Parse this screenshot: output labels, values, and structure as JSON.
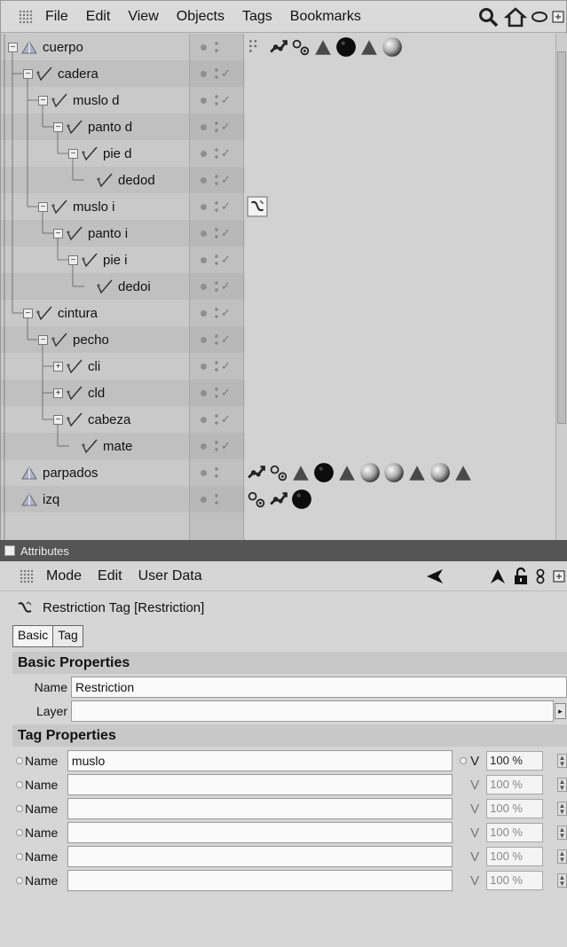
{
  "object_manager": {
    "menu": [
      "File",
      "Edit",
      "View",
      "Objects",
      "Tags",
      "Bookmarks"
    ],
    "header_icons": [
      "search-icon",
      "home-icon",
      "ellipse-icon",
      "window-expand-icon"
    ],
    "objects": [
      {
        "name": "cuerpo",
        "type": "joint-root",
        "expanded": true
      },
      {
        "name": "cadera",
        "type": "bone",
        "expanded": true
      },
      {
        "name": "muslo d",
        "type": "bone",
        "expanded": true
      },
      {
        "name": "panto d",
        "type": "bone",
        "expanded": true
      },
      {
        "name": "pie d",
        "type": "bone",
        "expanded": true
      },
      {
        "name": "dedod",
        "type": "bone",
        "expanded": null
      },
      {
        "name": "muslo i",
        "type": "bone",
        "expanded": true
      },
      {
        "name": "panto i",
        "type": "bone",
        "expanded": true
      },
      {
        "name": "pie i",
        "type": "bone",
        "expanded": true
      },
      {
        "name": "dedoi",
        "type": "bone",
        "expanded": null
      },
      {
        "name": "cintura",
        "type": "bone",
        "expanded": true
      },
      {
        "name": "pecho",
        "type": "bone",
        "expanded": true
      },
      {
        "name": "cli",
        "type": "bone",
        "expanded": false
      },
      {
        "name": "cld",
        "type": "bone",
        "expanded": false
      },
      {
        "name": "cabeza",
        "type": "bone",
        "expanded": true
      },
      {
        "name": "mate",
        "type": "bone",
        "expanded": null
      },
      {
        "name": "parpados",
        "type": "joint-root",
        "expanded": null
      },
      {
        "name": "izq",
        "type": "joint-root",
        "expanded": null
      }
    ],
    "tag_rows": [
      {
        "row": 0,
        "tags": [
          "grid-icon",
          "ik-chain-icon",
          "spheres-icon",
          "phong-tag-icon",
          "black-material-icon",
          "phong-tag-icon",
          "sphere-material-icon"
        ]
      },
      {
        "row": 6,
        "tags": [
          "restriction-tag-icon"
        ]
      },
      {
        "row": 16,
        "tags": [
          "ik-chain-icon",
          "spheres-icon",
          "phong-tag-icon",
          "black-material-icon",
          "phong-tag-icon",
          "sphere-material-icon",
          "sphere-material-icon",
          "phong-tag-icon",
          "sphere-material-icon",
          "phong-tag-icon"
        ]
      },
      {
        "row": 17,
        "tags": [
          "spheres-icon",
          "ik-chain-icon",
          "black-material-icon"
        ]
      }
    ]
  },
  "attributes": {
    "panel_title": "Attributes",
    "menu": [
      "Mode",
      "Edit",
      "User Data"
    ],
    "nav_icons": [
      "back-arrow-icon",
      "up-arrow-icon",
      "lock-icon",
      "link-icon",
      "window-expand-icon"
    ],
    "tag_title": "Restriction Tag [Restriction]",
    "tabs": [
      "Basic",
      "Tag"
    ],
    "basic_section": "Basic Properties",
    "basic": {
      "name_label": "Name",
      "name_value": "Restriction",
      "layer_label": "Layer",
      "layer_value": ""
    },
    "tag_section": "Tag Properties",
    "tag_entries": [
      {
        "label": "Name",
        "value": "muslo",
        "v_label": "V",
        "pct": "100 %",
        "active": true
      },
      {
        "label": "Name",
        "value": "",
        "v_label": "V",
        "pct": "100 %",
        "active": false
      },
      {
        "label": "Name",
        "value": "",
        "v_label": "V",
        "pct": "100 %",
        "active": false
      },
      {
        "label": "Name",
        "value": "",
        "v_label": "V",
        "pct": "100 %",
        "active": false
      },
      {
        "label": "Name",
        "value": "",
        "v_label": "V",
        "pct": "100 %",
        "active": false
      },
      {
        "label": "Name",
        "value": "",
        "v_label": "V",
        "pct": "100 %",
        "active": false
      }
    ]
  }
}
